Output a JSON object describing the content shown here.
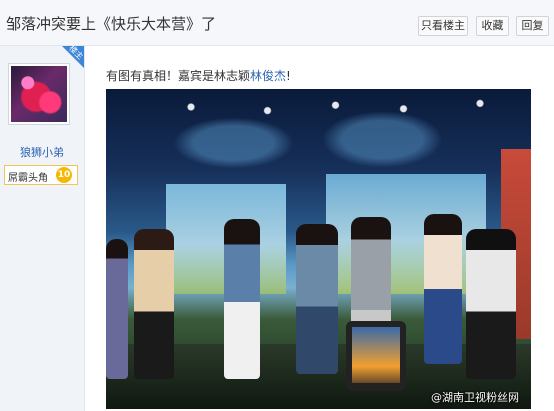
{
  "header": {
    "title": "邹落冲突要上《快乐大本营》了",
    "buttons": {
      "only_op": "只看楼主",
      "favorite": "收藏",
      "reply": "回复"
    }
  },
  "author": {
    "badge": "楼主",
    "name": "狼狮小弟",
    "level_title": "屌霸头角",
    "level": "10"
  },
  "post": {
    "text_before": "有图有真相！嘉宾是林志颖",
    "link": "林俊杰",
    "text_after": "!",
    "image": {
      "watermark": "@湖南卫视粉丝网"
    }
  },
  "colors": {
    "link": "#2d64b3",
    "badge": "#3b86d6",
    "level": "#f5b800"
  }
}
